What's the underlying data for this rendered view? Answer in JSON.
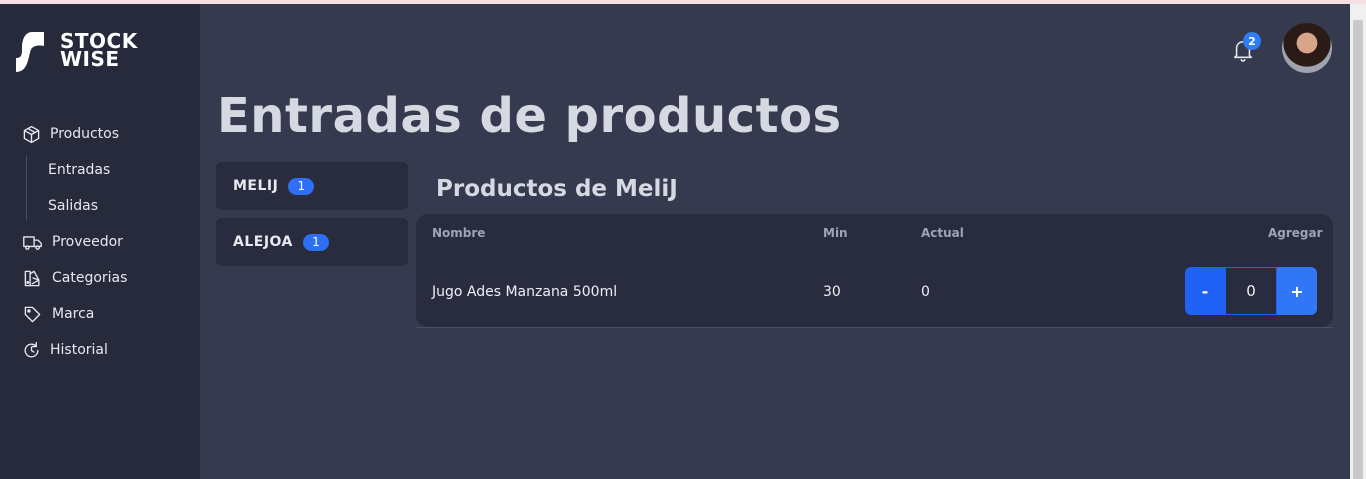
{
  "brand": {
    "line1": "STOCK",
    "line2": "WISE"
  },
  "nav": {
    "products": "Productos",
    "entries": "Entradas",
    "exits": "Salidas",
    "supplier": "Proveedor",
    "categories": "Categorias",
    "brand": "Marca",
    "history": "Historial"
  },
  "header": {
    "notifications_count": "2"
  },
  "page": {
    "title": "Entradas de productos"
  },
  "providers": [
    {
      "name": "MELIJ",
      "count": "1"
    },
    {
      "name": "ALEJOA",
      "count": "1"
    }
  ],
  "section": {
    "title": "Productos de MeliJ"
  },
  "table": {
    "columns": {
      "name": "Nombre",
      "min": "Min",
      "current": "Actual",
      "add": "Agregar"
    },
    "rows": [
      {
        "name": "Jugo Ades Manzana 500ml",
        "min": "30",
        "current": "0",
        "add_value": "0"
      }
    ]
  },
  "stepper": {
    "minus": "-",
    "plus": "+"
  },
  "colors": {
    "accent": "#2f6ff5",
    "sidebar": "#262a3b",
    "background": "#363a4f",
    "card": "#282c3e"
  }
}
